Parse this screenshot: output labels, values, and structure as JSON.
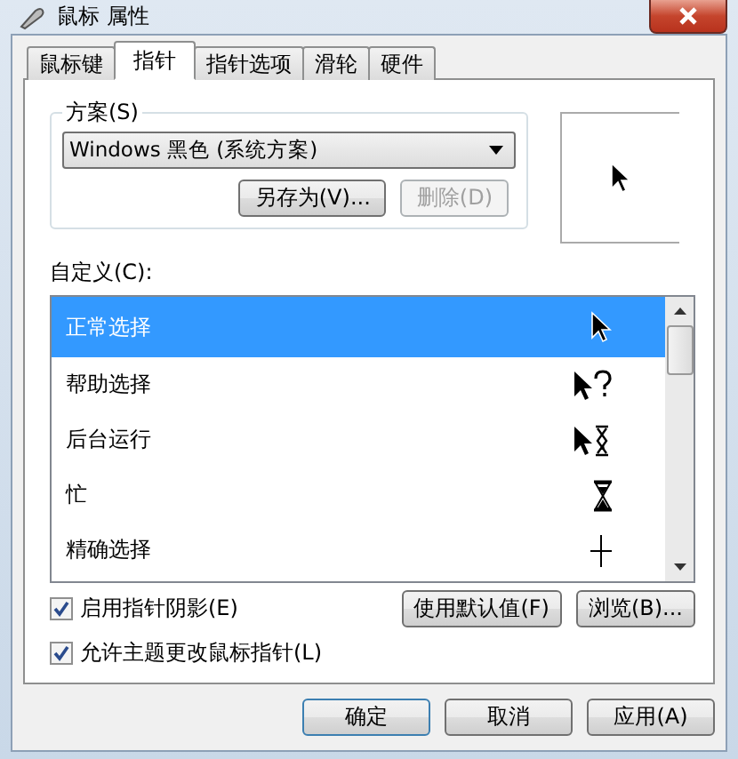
{
  "window": {
    "title": "鼠标 属性"
  },
  "tabs": [
    {
      "label": "鼠标键",
      "selected": false
    },
    {
      "label": "指针",
      "selected": true
    },
    {
      "label": "指针选项",
      "selected": false
    },
    {
      "label": "滑轮",
      "selected": false
    },
    {
      "label": "硬件",
      "selected": false
    }
  ],
  "scheme": {
    "label": "方案(S)",
    "value": "Windows 黑色 (系统方案)",
    "buttons": [
      {
        "label": "另存为(V)...",
        "disabled": false
      },
      {
        "label": "删除(D)",
        "disabled": true
      }
    ]
  },
  "customize": {
    "label": "自定义(C):",
    "cursors": [
      {
        "name": "正常选择",
        "kind": "arrow",
        "selected": true
      },
      {
        "name": "帮助选择",
        "kind": "help",
        "selected": false
      },
      {
        "name": "后台运行",
        "kind": "working",
        "selected": false
      },
      {
        "name": "忙",
        "kind": "busy",
        "selected": false
      },
      {
        "name": "精确选择",
        "kind": "precision",
        "selected": false
      }
    ]
  },
  "options": [
    {
      "label": "启用指针阴影(E)",
      "checked": true
    },
    {
      "label": "允许主题更改鼠标指针(L)",
      "checked": true
    }
  ],
  "list_buttons": [
    "使用默认值(F)",
    "浏览(B)..."
  ],
  "dialog_buttons": [
    "确定",
    "取消",
    "应用(A)"
  ]
}
